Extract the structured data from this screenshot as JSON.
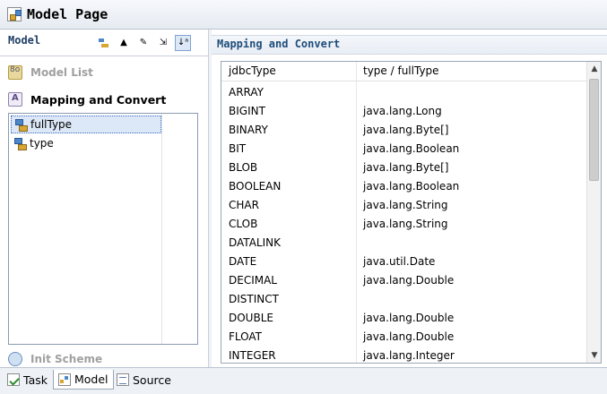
{
  "window": {
    "title": "Model Page"
  },
  "left_panel": {
    "label": "Model",
    "toolbar": [
      "blocks-icon",
      "sort-icon",
      "edit-icon",
      "export-icon",
      "sort-az-icon"
    ],
    "sections": {
      "model_list": "Model List",
      "mapping": "Mapping and Convert",
      "init_scheme": "Init Scheme"
    },
    "tree_items": [
      {
        "label": "fullType",
        "selected": true
      },
      {
        "label": "type",
        "selected": false
      }
    ]
  },
  "right_panel": {
    "title": "Mapping and Convert",
    "columns": [
      "jdbcType",
      "type / fullType"
    ],
    "rows": [
      [
        "ARRAY",
        ""
      ],
      [
        "BIGINT",
        "java.lang.Long"
      ],
      [
        "BINARY",
        "java.lang.Byte[]"
      ],
      [
        "BIT",
        "java.lang.Boolean"
      ],
      [
        "BLOB",
        "java.lang.Byte[]"
      ],
      [
        "BOOLEAN",
        "java.lang.Boolean"
      ],
      [
        "CHAR",
        "java.lang.String"
      ],
      [
        "CLOB",
        "java.lang.String"
      ],
      [
        "DATALINK",
        ""
      ],
      [
        "DATE",
        "java.util.Date"
      ],
      [
        "DECIMAL",
        "java.lang.Double"
      ],
      [
        "DISTINCT",
        ""
      ],
      [
        "DOUBLE",
        "java.lang.Double"
      ],
      [
        "FLOAT",
        "java.lang.Double"
      ],
      [
        "INTEGER",
        "java.lang.Integer"
      ]
    ]
  },
  "bottom_tabs": [
    {
      "label": "Task",
      "active": false
    },
    {
      "label": "Model",
      "active": true
    },
    {
      "label": "Source",
      "active": false
    }
  ]
}
